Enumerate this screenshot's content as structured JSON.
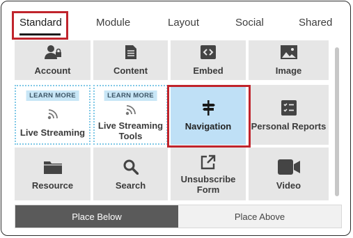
{
  "tabs": [
    {
      "label": "Standard",
      "active": true
    },
    {
      "label": "Module"
    },
    {
      "label": "Layout"
    },
    {
      "label": "Social"
    },
    {
      "label": "Shared"
    }
  ],
  "tiles": [
    {
      "label": "Account",
      "icon": "account-lock-icon"
    },
    {
      "label": "Content",
      "icon": "document-icon"
    },
    {
      "label": "Embed",
      "icon": "code-icon"
    },
    {
      "label": "Image",
      "icon": "image-icon"
    },
    {
      "label": "Live Streaming",
      "icon": "broadcast-icon",
      "badge": "LEARN MORE"
    },
    {
      "label": "Live Streaming Tools",
      "icon": "broadcast-icon",
      "badge": "LEARN MORE"
    },
    {
      "label": "Navigation",
      "icon": "signpost-icon",
      "selected": true
    },
    {
      "label": "Personal Reports",
      "icon": "checklist-icon"
    },
    {
      "label": "Resource",
      "icon": "folder-icon"
    },
    {
      "label": "Search",
      "icon": "search-icon"
    },
    {
      "label": "Unsubscribe Form",
      "icon": "external-link-icon"
    },
    {
      "label": "Video",
      "icon": "video-camera-icon"
    }
  ],
  "placement": {
    "below_label": "Place Below",
    "above_label": "Place Above",
    "selected": "below"
  },
  "colors": {
    "highlight": "#c0242c",
    "selected_tile": "#bfe0f6",
    "badge": "#c8e6f6"
  }
}
